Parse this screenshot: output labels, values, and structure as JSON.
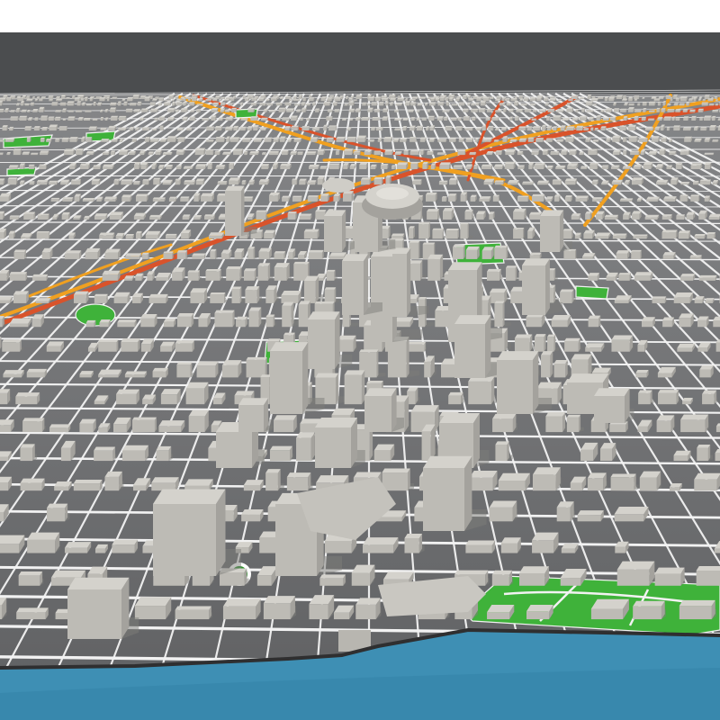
{
  "scene": {
    "colors": {
      "top_band": "#ffffff",
      "sky": "#4b4d4f",
      "ground": "#6e6f71",
      "ground_near": "#5f6062",
      "street": "#f2f2f2",
      "building_top": "#d4d2cc",
      "building_side": "#a4a29d",
      "building_shadow": "#7e7d79",
      "park": "#3fb23a",
      "park_dark": "#2d8f2a",
      "highway": "#f0a020",
      "highway_red": "#d9532b",
      "water": "#3e8fb4",
      "water_deep": "#2f7aa0"
    },
    "features": {
      "landmarks": [
        "stadium-dome",
        "arena"
      ],
      "parks": [
        "riverfront-park",
        "upper-left-park",
        "central-park",
        "roundabout-park"
      ],
      "water": "river"
    }
  }
}
